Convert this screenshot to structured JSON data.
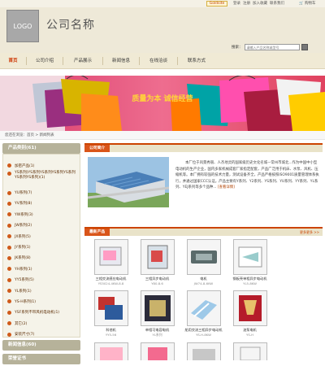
{
  "topbar": {
    "badge": "Goldsite",
    "links": [
      "登录",
      "注册",
      "加入收藏",
      "联系我们"
    ],
    "cart": "购物车"
  },
  "header": {
    "logo_text": "LOGO",
    "company_name": "公司名称",
    "search_label": "搜索：",
    "search_placeholder": "请输入产品名称或型号"
  },
  "nav": [
    "首页",
    "公司介绍",
    "产品展示",
    "新闻信息",
    "在线洽谈",
    "联系方式"
  ],
  "banner": {
    "slogan": "质量为本  诚信经营"
  },
  "breadcrumb": "您还在浏览：首页  >  新闻列表",
  "sidebar": {
    "categories_title": "产品类别(61)",
    "categories": [
      "加密产品(1)",
      "YS系列(YS系列YS系列YS系列YS系列YS系列YS系列)(1)",
      "YU系列(7)",
      "YV系列(8)",
      "YW系列(3)",
      "JW系列(2)",
      "JX系列(5)",
      "JY系列(1)",
      "JK系列(8)",
      "YH系列(1)",
      "YY5系列(5)",
      "YL系列(1)",
      "YS-H系列(1)",
      "YSF系列不带风机电动机(1)",
      "其它(2)",
      "安装尺寸(7)"
    ],
    "news_title": "新闻信息(60)",
    "honor_title": "荣誉证书"
  },
  "intro": {
    "title": "公司简介",
    "text": "本厂位于风景秀丽、人杰地灵的国家级历史文化名城—常州市城北...作为中国中小型电动机的生产企业，国内多家机械成套厂家指定配套，产品广泛用于机床、水泵、风机、压缩机等。本厂拥有较强的技术力量，测试设备齐全，产品严格按照ISO9001质量管理体系执行，并通过国家CCC认证。产品主要有Y系列、Y2系列、YS系列、YU系列、YY系列、YL系列、YEJ系列等多个品种...",
    "more": "[查看详情]"
  },
  "products": {
    "title": "最新产品",
    "more": "更多更多 >>",
    "items": [
      {
        "name": "三相交流感应电动机",
        "code": "YS5024-4KW-8.8"
      },
      {
        "name": "三相异步电动机",
        "code": "Y80-8.6"
      },
      {
        "name": "电机",
        "code": "JW74-8-6KW"
      },
      {
        "name": "钢板壳单相异步电动机",
        "code": "YL5-8KW"
      },
      {
        "name": "",
        "code": ""
      },
      {
        "name": "科他机",
        "code": "YY5-56"
      },
      {
        "name": "单相可电容电机",
        "code": "YL系列"
      },
      {
        "name": "船用交流三相异步电动机",
        "code": "YS-H-8KW"
      },
      {
        "name": "油泵电机",
        "code": "YS-H"
      },
      {
        "name": "",
        "code": ""
      }
    ]
  },
  "colors": {
    "accent": "#cc4400",
    "nav_bg": "#f0ead5",
    "sidebar_head": "#b6b29a"
  }
}
